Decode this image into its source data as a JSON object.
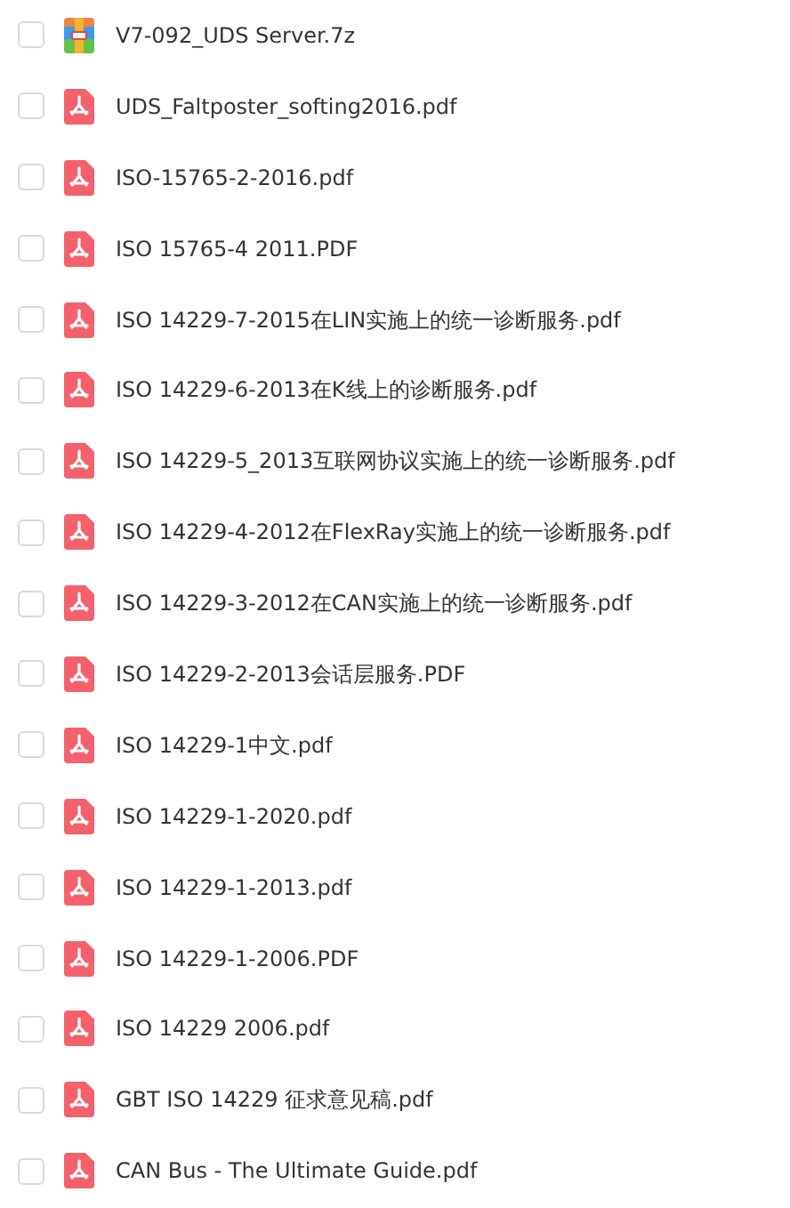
{
  "files": [
    {
      "name": "V7-092_UDS Server.7z",
      "kind": "archive",
      "checked": false
    },
    {
      "name": "UDS_Faltposter_softing2016.pdf",
      "kind": "pdf",
      "checked": false
    },
    {
      "name": "ISO-15765-2-2016.pdf",
      "kind": "pdf",
      "checked": false
    },
    {
      "name": "ISO 15765-4 2011.PDF",
      "kind": "pdf",
      "checked": false
    },
    {
      "name": "ISO 14229-7-2015在LIN实施上的统一诊断服务.pdf",
      "kind": "pdf",
      "checked": false
    },
    {
      "name": "ISO 14229-6-2013在K线上的诊断服务.pdf",
      "kind": "pdf",
      "checked": false
    },
    {
      "name": "ISO 14229-5_2013互联网协议实施上的统一诊断服务.pdf",
      "kind": "pdf",
      "checked": false
    },
    {
      "name": "ISO 14229-4-2012在FlexRay实施上的统一诊断服务.pdf",
      "kind": "pdf",
      "checked": false
    },
    {
      "name": "ISO 14229-3-2012在CAN实施上的统一诊断服务.pdf",
      "kind": "pdf",
      "checked": false
    },
    {
      "name": "ISO 14229-2-2013会话层服务.PDF",
      "kind": "pdf",
      "checked": false
    },
    {
      "name": "ISO 14229-1中文.pdf",
      "kind": "pdf",
      "checked": false
    },
    {
      "name": "ISO 14229-1-2020.pdf",
      "kind": "pdf",
      "checked": false
    },
    {
      "name": "ISO 14229-1-2013.pdf",
      "kind": "pdf",
      "checked": false
    },
    {
      "name": "ISO 14229-1-2006.PDF",
      "kind": "pdf",
      "checked": false
    },
    {
      "name": "ISO 14229 2006.pdf",
      "kind": "pdf",
      "checked": false
    },
    {
      "name": "GBT ISO 14229 征求意见稿.pdf",
      "kind": "pdf",
      "checked": false
    },
    {
      "name": "CAN Bus - The Ultimate Guide.pdf",
      "kind": "pdf",
      "checked": false
    }
  ]
}
